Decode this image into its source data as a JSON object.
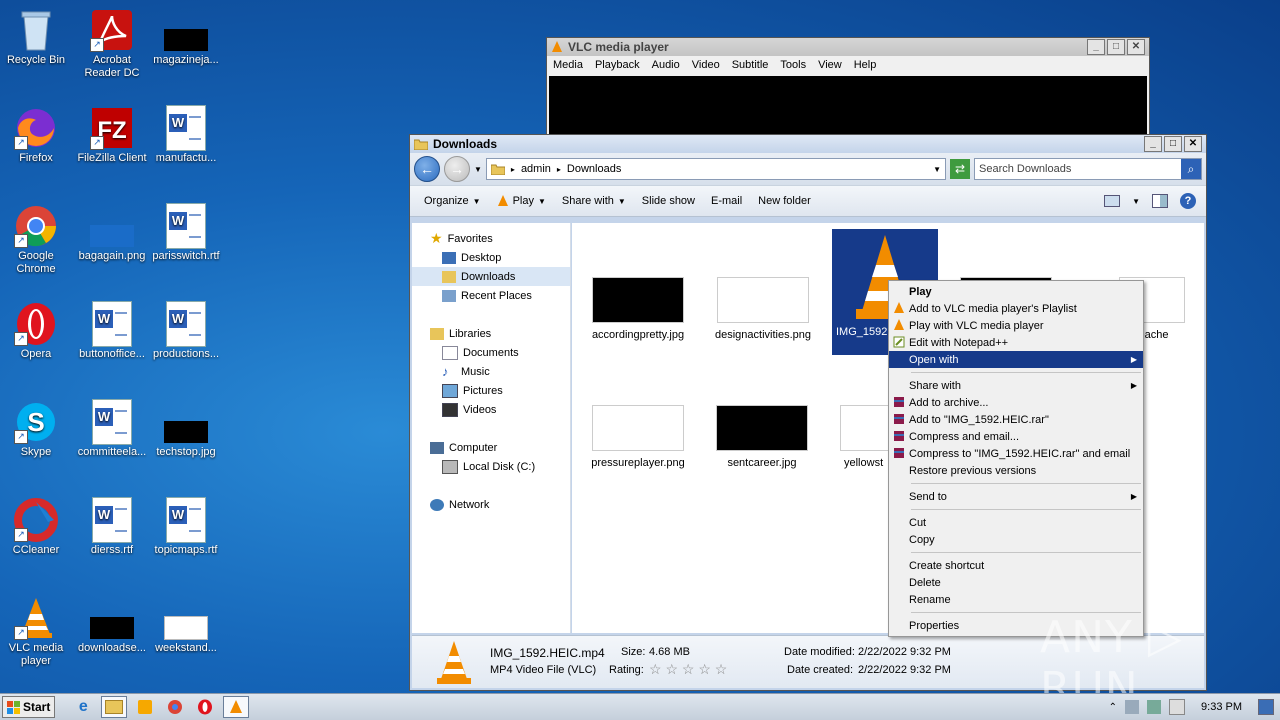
{
  "desktop": {
    "icons": [
      {
        "label": "Recycle Bin"
      },
      {
        "label": "Acrobat Reader DC"
      },
      {
        "label": "magazineja..."
      },
      {
        "label": "Firefox"
      },
      {
        "label": "FileZilla Client"
      },
      {
        "label": "manufactu..."
      },
      {
        "label": "Google Chrome"
      },
      {
        "label": "bagagain.png"
      },
      {
        "label": "parisswitch.rtf"
      },
      {
        "label": "Opera"
      },
      {
        "label": "buttonoffice..."
      },
      {
        "label": "productions..."
      },
      {
        "label": "Skype"
      },
      {
        "label": "committeela..."
      },
      {
        "label": "techstop.jpg"
      },
      {
        "label": "CCleaner"
      },
      {
        "label": "dierss.rtf"
      },
      {
        "label": "topicmaps.rtf"
      },
      {
        "label": "VLC media player"
      },
      {
        "label": "downloadse..."
      },
      {
        "label": "weekstand..."
      }
    ]
  },
  "vlc": {
    "title": "VLC media player",
    "menu": [
      "Media",
      "Playback",
      "Audio",
      "Video",
      "Subtitle",
      "Tools",
      "View",
      "Help"
    ]
  },
  "explorer": {
    "title": "Downloads",
    "breadcrumb": [
      "admin",
      "Downloads"
    ],
    "search_placeholder": "Search Downloads",
    "toolbar": {
      "organize": "Organize",
      "play": "Play",
      "share_with": "Share with",
      "slide_show": "Slide show",
      "email": "E-mail",
      "new_folder": "New folder"
    },
    "nav": {
      "favorites": "Favorites",
      "desktop": "Desktop",
      "downloads": "Downloads",
      "recent": "Recent Places",
      "libraries": "Libraries",
      "documents": "Documents",
      "music": "Music",
      "pictures": "Pictures",
      "videos": "Videos",
      "computer": "Computer",
      "local_disk": "Local Disk (C:)",
      "network": "Network"
    },
    "files": [
      {
        "name": "accordingpretty.jpg"
      },
      {
        "name": "designactivities.png"
      },
      {
        "name": "IMG_1592"
      },
      {
        "name": "teache"
      },
      {
        "name": "pressureplayer.png"
      },
      {
        "name": "sentcareer.jpg"
      },
      {
        "name": "yellowst"
      }
    ],
    "details": {
      "filename": "IMG_1592.HEIC.mp4",
      "type": "MP4 Video File (VLC)",
      "size_label": "Size:",
      "size": "4.68 MB",
      "rating_label": "Rating:",
      "rating_stars": "☆ ☆ ☆ ☆ ☆",
      "modified_label": "Date modified:",
      "modified": "2/22/2022 9:32 PM",
      "created_label": "Date created:",
      "created": "2/22/2022 9:32 PM"
    }
  },
  "context_menu": {
    "play": "Play",
    "add_playlist": "Add to VLC media player's Playlist",
    "play_with_vlc": "Play with VLC media player",
    "edit_notepad": "Edit with Notepad++",
    "open_with": "Open with",
    "share_with": "Share with",
    "add_archive": "Add to archive...",
    "add_rar": "Add to \"IMG_1592.HEIC.rar\"",
    "compress_email": "Compress and email...",
    "compress_rar_email": "Compress to \"IMG_1592.HEIC.rar\" and email",
    "restore": "Restore previous versions",
    "send_to": "Send to",
    "cut": "Cut",
    "copy": "Copy",
    "create_shortcut": "Create shortcut",
    "delete": "Delete",
    "rename": "Rename",
    "properties": "Properties"
  },
  "taskbar": {
    "start": "Start",
    "clock": "9:33 PM"
  },
  "watermark": "ANY ▷ RUN",
  "colors": {
    "selection": "#163a8a",
    "vlc_orange": "#f28c00"
  }
}
